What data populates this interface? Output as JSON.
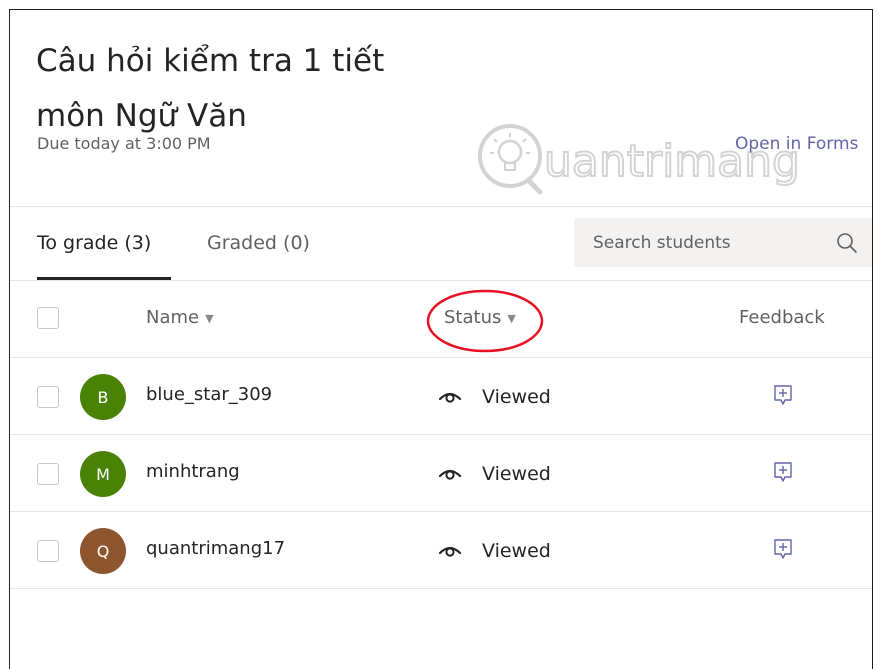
{
  "assignment": {
    "title_line1": "Câu hỏi kiểm tra 1 tiết",
    "title_line2": "môn Ngữ Văn",
    "due": "Due today at 3:00 PM",
    "open_in_forms": "Open in Forms"
  },
  "watermark": {
    "text": "uantrimang"
  },
  "tabs": [
    {
      "label": "To grade (3)",
      "active": true
    },
    {
      "label": "Graded (0)",
      "active": false
    }
  ],
  "search": {
    "placeholder": "Search students",
    "icon": "search-icon"
  },
  "table": {
    "headers": {
      "name": "Name",
      "status": "Status",
      "feedback": "Feedback"
    },
    "rows": [
      {
        "initial": "B",
        "name": "blue_star_309",
        "status": "Viewed",
        "avatar_color": "#498205"
      },
      {
        "initial": "M",
        "name": "minhtrang",
        "status": "Viewed",
        "avatar_color": "#498205"
      },
      {
        "initial": "Q",
        "name": "quantrimang17",
        "status": "Viewed",
        "avatar_color": "#8e562e"
      }
    ]
  },
  "colors": {
    "accent": "#6264a7",
    "annotation": "#e81123"
  }
}
